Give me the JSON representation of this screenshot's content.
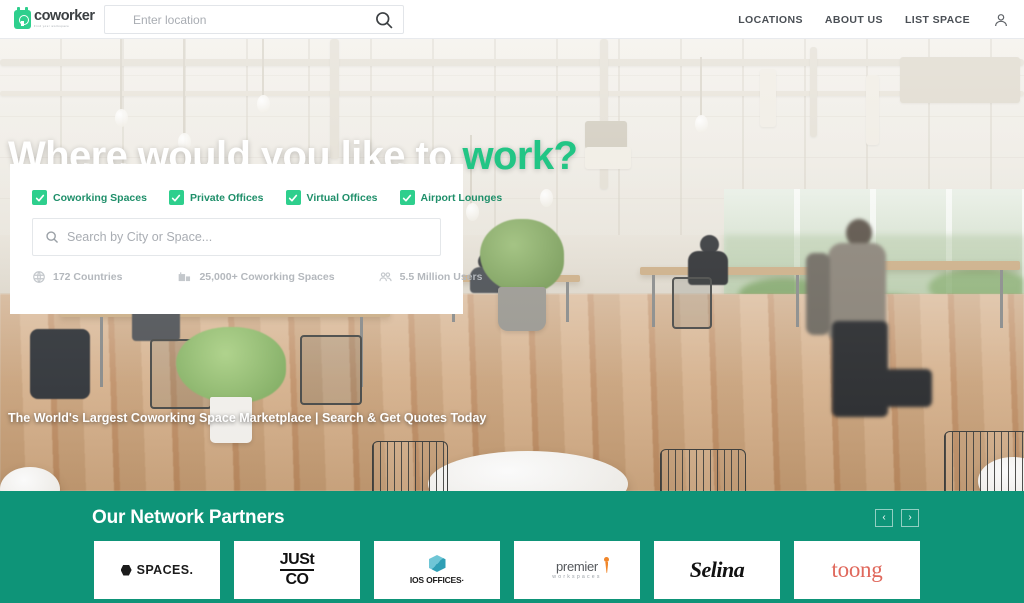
{
  "header": {
    "logo": {
      "word": "coworker",
      "subtitle": "Find your workspace",
      "icon": "coworker-logo-icon"
    },
    "search": {
      "placeholder": "Enter location",
      "value": "",
      "icon": "search-icon"
    },
    "nav": [
      {
        "label": "LOCATIONS"
      },
      {
        "label": "ABOUT US"
      },
      {
        "label": "LIST SPACE"
      }
    ],
    "account_icon": "user-account-icon"
  },
  "hero": {
    "title_plain": "Where would you like to ",
    "title_accent": "work?",
    "tagline": "The World's Largest Coworking Space Marketplace | Search & Get Quotes Today"
  },
  "search_card": {
    "filters": [
      {
        "label": "Coworking Spaces",
        "checked": true
      },
      {
        "label": "Private Offices",
        "checked": true
      },
      {
        "label": "Virtual Offices",
        "checked": true
      },
      {
        "label": "Airport Lounges",
        "checked": true
      }
    ],
    "search": {
      "placeholder": "Search by City or Space...",
      "value": "",
      "icon": "search-icon"
    },
    "stats": [
      {
        "label": "172 Countries",
        "icon": "globe-icon"
      },
      {
        "label": "25,000+ Coworking Spaces",
        "icon": "office-building-icon"
      },
      {
        "label": "5.5 Million Users",
        "icon": "users-group-icon"
      }
    ]
  },
  "partners": {
    "title": "Our Network Partners",
    "prev_label": "‹",
    "next_label": "›",
    "items": [
      {
        "name": "SPACES.",
        "style": "spaces"
      },
      {
        "name": "JUST CO",
        "line1": "JUSt",
        "line2": "CO",
        "style": "justco"
      },
      {
        "name": "IOS OFFICES",
        "label": "IOS OFFICES·",
        "style": "ios"
      },
      {
        "name": "premier workspaces",
        "line1": "premier",
        "line2": "workspaces",
        "style": "premier"
      },
      {
        "name": "Selina",
        "label": "Selina",
        "style": "selina"
      },
      {
        "name": "toong",
        "label": "toong",
        "style": "toong"
      }
    ]
  },
  "colors": {
    "brand_teal": "#0e9478",
    "accent_green": "#2ecf8d",
    "heading_accent": "#22c585",
    "filter_text": "#1f8f6a",
    "muted_text": "#b4b8bd"
  }
}
